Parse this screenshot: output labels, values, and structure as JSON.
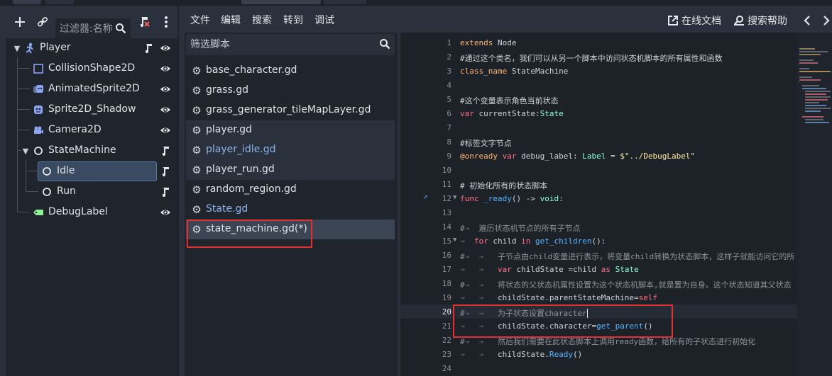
{
  "scene": {
    "filter_placeholder": "过滤器:名称",
    "nodes": [
      {
        "label": "Player",
        "icon": "player-node-icon",
        "right_icons": [
          "script-icon",
          "visibility-icon"
        ]
      },
      {
        "label": "CollisionShape2D",
        "icon": "collision-shape-icon",
        "right_icons": [
          "visibility-icon"
        ]
      },
      {
        "label": "AnimatedSprite2D",
        "icon": "animated-sprite-icon",
        "right_icons": [
          "visibility-icon"
        ]
      },
      {
        "label": "Sprite2D_Shadow",
        "icon": "sprite-icon",
        "right_icons": [
          "visibility-icon"
        ]
      },
      {
        "label": "Camera2D",
        "icon": "camera-icon",
        "right_icons": [
          "visibility-icon"
        ]
      },
      {
        "label": "StateMachine",
        "icon": "node-circle-icon",
        "right_icons": [
          "script-icon"
        ]
      },
      {
        "label": "Idle",
        "icon": "node-circle-icon",
        "right_icons": [
          "script-icon"
        ]
      },
      {
        "label": "Run",
        "icon": "node-circle-icon",
        "right_icons": [
          "script-icon"
        ]
      },
      {
        "label": "DebugLabel",
        "icon": "label-icon",
        "right_icons": [
          "visibility-icon"
        ]
      }
    ]
  },
  "editor": {
    "menu": [
      "文件",
      "编辑",
      "搜索",
      "转到",
      "调试"
    ],
    "online_docs": "在线文档",
    "search_help": "搜索帮助",
    "script_filter_placeholder": "筛选脚本",
    "scripts": [
      "base_character.gd",
      "grass.gd",
      "grass_generator_tileMapLayer.gd",
      "player.gd",
      "player_idle.gd",
      "player_run.gd",
      "random_region.gd",
      "State.gd",
      "state_machine.gd(*)"
    ]
  },
  "code": {
    "line_numbers": [
      "1",
      "2",
      "3",
      "4",
      "5",
      "6",
      "7",
      "8",
      "9",
      "10",
      "11",
      "12",
      "13",
      "14",
      "15",
      "16",
      "17",
      "18",
      "19",
      "20",
      "21",
      "22",
      "23",
      "24"
    ],
    "l1": [
      "extends",
      " Node"
    ],
    "l2": "#通过这个类名，我们可以从另一个脚本中访问状态机脚本的所有属性和函数",
    "l3": [
      "class_name",
      " StateMachine"
    ],
    "l5": "#这个变量表示角色当前状态",
    "l6": [
      "var",
      " currentState:",
      "State"
    ],
    "l8": "#标签文字节点",
    "l9": [
      "@onready",
      " var",
      " debug_label: ",
      "Label",
      " = ",
      "$\"../DebugLabel\""
    ],
    "l11": "# 初始化所有的状态脚本",
    "l12": [
      "func",
      " _ready",
      "() -> ",
      "void",
      ":"
    ],
    "l14": "遍历状态机节点的所有子节点",
    "l15": [
      "for",
      " child ",
      "in",
      " get_children",
      "():"
    ],
    "l16": "子节点由child变量进行表示，将变量child转换为状态脚本，这样子就能访问它的所",
    "l17": [
      "var",
      " childState =child ",
      "as",
      " State"
    ],
    "l18": "将状态的父状态机属性设置为这个状态机脚本,就是置为自身。这个状态知道其父状态",
    "l19": [
      "childState.parentStateMachine=",
      "self"
    ],
    "l20": "为子状态设置character",
    "l21": [
      "childState.character=",
      "get_parent",
      "()"
    ],
    "l22": "然后我们需要在此状态脚本上调用ready函数，给所有的子状态进行初始化",
    "l23": [
      "childState.",
      "Ready",
      "()"
    ],
    "comment_mark": "#",
    "tab_mark": "⇥"
  }
}
